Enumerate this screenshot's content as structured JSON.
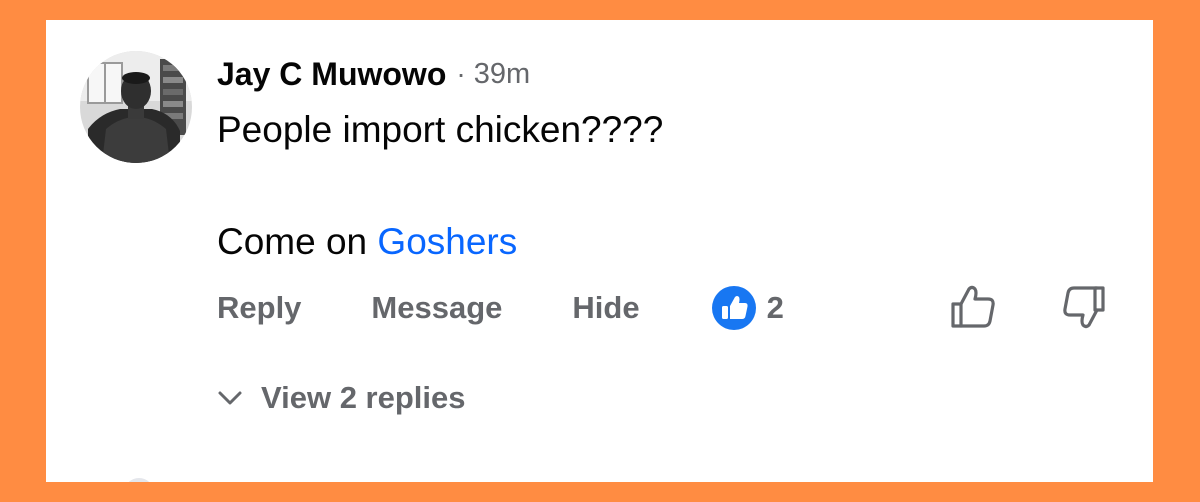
{
  "comment": {
    "author": "Jay C Muwowo",
    "separator": "·",
    "time": "39m",
    "text_line1": "People import chicken????",
    "text_line2_prefix": "Come on ",
    "mention": "Goshers"
  },
  "actions": {
    "reply_label": "Reply",
    "message_label": "Message",
    "hide_label": "Hide",
    "like_count": "2"
  },
  "replies": {
    "label": "View 2 replies"
  },
  "colors": {
    "background": "#FF8C42",
    "card": "#FFFFFF",
    "text": "#050505",
    "muted": "#65676B",
    "link": "#0866FF",
    "like_badge": "#1877F2"
  },
  "icons": {
    "like_badge": "thumbs-up-badge-icon",
    "upvote": "thumbs-up-outline-icon",
    "downvote": "thumbs-down-outline-icon",
    "expand": "chevron-down-icon"
  }
}
